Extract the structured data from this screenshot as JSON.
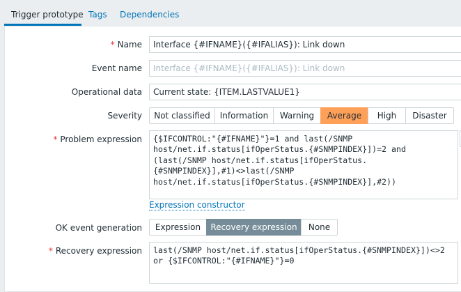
{
  "tabs": [
    {
      "label": "Trigger prototype",
      "active": true
    },
    {
      "label": "Tags",
      "active": false
    },
    {
      "label": "Dependencies",
      "active": false
    }
  ],
  "form": {
    "required_marker": "*",
    "name": {
      "label": "Name",
      "value": "Interface {#IFNAME}({#IFALIAS}): Link down"
    },
    "event_name": {
      "label": "Event name",
      "placeholder": "Interface {#IFNAME}({#IFALIAS}): Link down"
    },
    "operational_data": {
      "label": "Operational data",
      "value": "Current state: {ITEM.LASTVALUE1}"
    },
    "severity": {
      "label": "Severity",
      "options": [
        "Not classified",
        "Information",
        "Warning",
        "Average",
        "High",
        "Disaster"
      ],
      "selected": "Average"
    },
    "problem_expression": {
      "label": "Problem expression",
      "value": "{$IFCONTROL:\"{#IFNAME}\"}=1 and last(/SNMP\nhost/net.if.status[ifOperStatus.{#SNMPINDEX}])=2 and\n(last(/SNMP host/net.if.status[ifOperStatus.\n{#SNMPINDEX}],#1)<>last(/SNMP\nhost/net.if.status[ifOperStatus.{#SNMPINDEX}],#2))"
    },
    "expression_constructor_link": "Expression constructor",
    "ok_event_generation": {
      "label": "OK event generation",
      "options": [
        "Expression",
        "Recovery expression",
        "None"
      ],
      "selected": "Recovery expression"
    },
    "recovery_expression": {
      "label": "Recovery expression",
      "value": "last(/SNMP host/net.if.status[ifOperStatus.{#SNMPINDEX}])<>2\nor {$IFCONTROL:\"{#IFNAME}\"}=0"
    }
  },
  "colors": {
    "accent": "#0275b8",
    "required": "#e33734",
    "severity_average": "#ffa059",
    "selected_segment": "#768d99"
  }
}
